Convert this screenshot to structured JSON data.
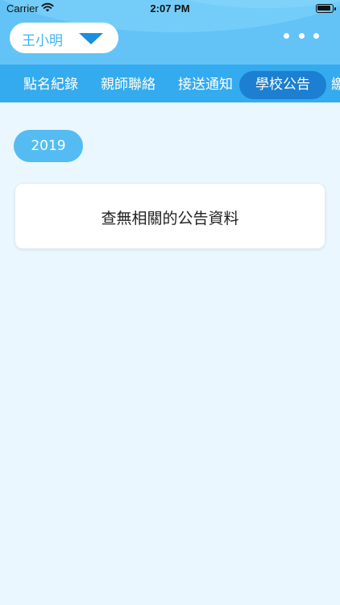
{
  "status_bar": {
    "carrier": "Carrier",
    "time": "2:07 PM",
    "wifi_icon": "wifi-icon",
    "battery_icon": "battery-icon"
  },
  "header": {
    "student_name": "王小明",
    "dropdown_icon": "chevron-down-icon",
    "more_icon": "more-horizontal-icon"
  },
  "tabs": [
    {
      "label": "點名紀錄",
      "active": false
    },
    {
      "label": "親師聯絡",
      "active": false
    },
    {
      "label": "接送通知",
      "active": false
    },
    {
      "label": "學校公告",
      "active": true
    },
    {
      "label": "繳",
      "active": false
    }
  ],
  "content": {
    "year_label": "2019",
    "empty_message": "查無相關的公告資料"
  },
  "colors": {
    "header": "#63c3f6",
    "tab_bar": "#34abee",
    "tab_active": "#1c7fd1",
    "background": "#eaf7fe",
    "year_pill": "#54bcf3",
    "caret": "#1a8fdf"
  }
}
